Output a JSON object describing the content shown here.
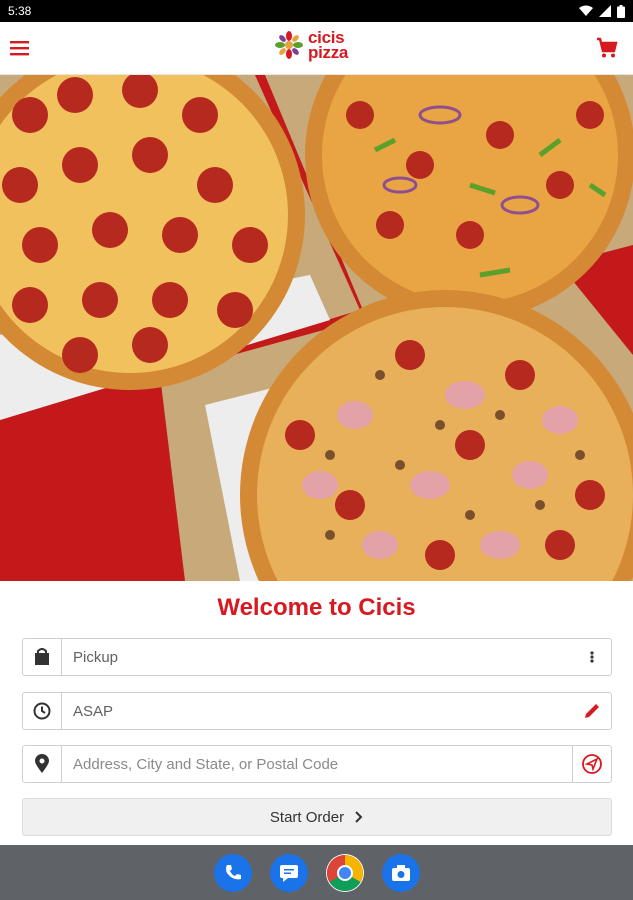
{
  "status_bar": {
    "time": "5:38"
  },
  "app": {
    "logo_line1": "cicis",
    "logo_line2": "pizza",
    "menu_icon": "menu-icon",
    "cart_icon": "cart-icon"
  },
  "colors": {
    "brand_red": "#d71920",
    "hero_bg": "#c3191b"
  },
  "welcome_title": "Welcome to Cicis",
  "form": {
    "order_type": {
      "value": "Pickup",
      "icon": "shopping-bag-icon",
      "trail_icon": "more-vert-icon"
    },
    "time": {
      "value": "ASAP",
      "icon": "clock-icon",
      "trail_icon": "pencil-icon"
    },
    "address": {
      "placeholder": "Address, City and State, or Postal Code",
      "icon": "location-pin-icon",
      "trail_icon": "locate-me-icon"
    },
    "start_order_label": "Start Order"
  },
  "dock": [
    "phone-icon",
    "messages-icon",
    "chrome-icon",
    "camera-icon"
  ]
}
